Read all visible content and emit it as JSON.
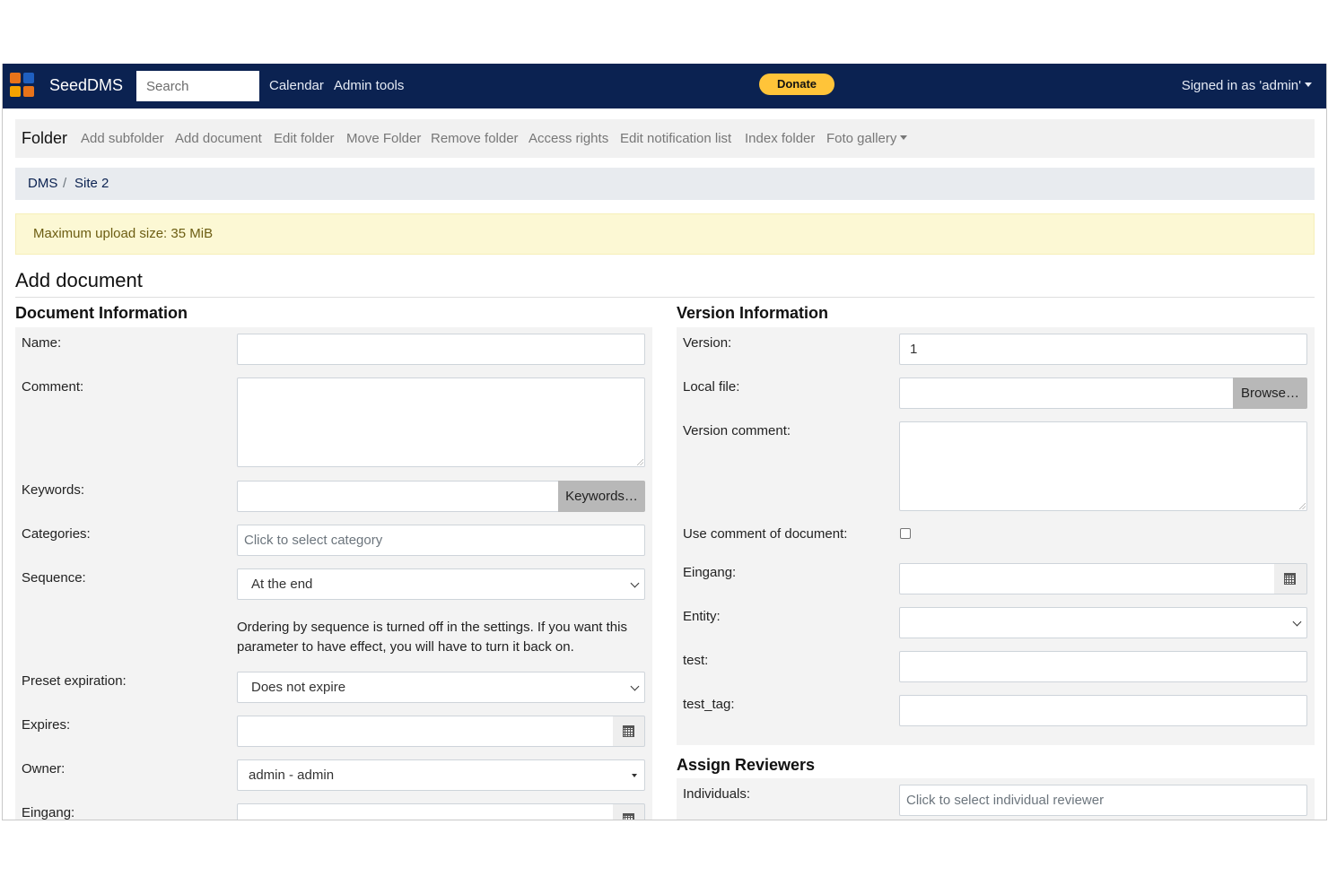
{
  "header": {
    "brand": "SeedDMS",
    "search_placeholder": "Search",
    "nav": [
      "Calendar",
      "Admin tools"
    ],
    "donate_label": "Donate",
    "signed_in": "Signed in as 'admin'"
  },
  "folder_menu": {
    "title": "Folder",
    "items": [
      "Add subfolder",
      "Add document",
      "Edit folder",
      "Move Folder",
      "Remove folder",
      "Access rights",
      "Edit notification list",
      "Index folder",
      "Foto gallery"
    ]
  },
  "breadcrumb": [
    "DMS",
    "/",
    "Site 2"
  ],
  "alert": "Maximum upload size: 35 MiB",
  "page_title": "Add document",
  "document_info": {
    "heading": "Document Information",
    "name_label": "Name:",
    "comment_label": "Comment:",
    "keywords_label": "Keywords:",
    "keywords_button": "Keywords…",
    "categories_label": "Categories:",
    "categories_placeholder": "Click to select category",
    "sequence_label": "Sequence:",
    "sequence_value": "At the end",
    "sequence_help_1": "Ordering by sequence is turned off in the settings. If you want this",
    "sequence_help_2": "parameter to have effect, you will have to turn it back on.",
    "preset_label": "Preset expiration:",
    "preset_value": "Does not expire",
    "expires_label": "Expires:",
    "owner_label": "Owner:",
    "owner_value": "admin - admin",
    "eingang_label": "Eingang:"
  },
  "version_info": {
    "heading": "Version Information",
    "version_label": "Version:",
    "version_value": "1",
    "local_file_label": "Local file:",
    "browse_button": "Browse…",
    "version_comment_label": "Version comment:",
    "use_comment_label": "Use comment of document:",
    "use_comment_checked": false,
    "eingang_label": "Eingang:",
    "entity_label": "Entity:",
    "test_label": "test:",
    "test_tag_label": "test_tag:"
  },
  "reviewers": {
    "heading": "Assign Reviewers",
    "individuals_label": "Individuals:",
    "individuals_placeholder": "Click to select individual reviewer"
  },
  "colors": {
    "navbar": "#0b2251",
    "donate": "#ffc439",
    "alert_bg": "#fcf8d4",
    "alert_text": "#6c5d12"
  }
}
